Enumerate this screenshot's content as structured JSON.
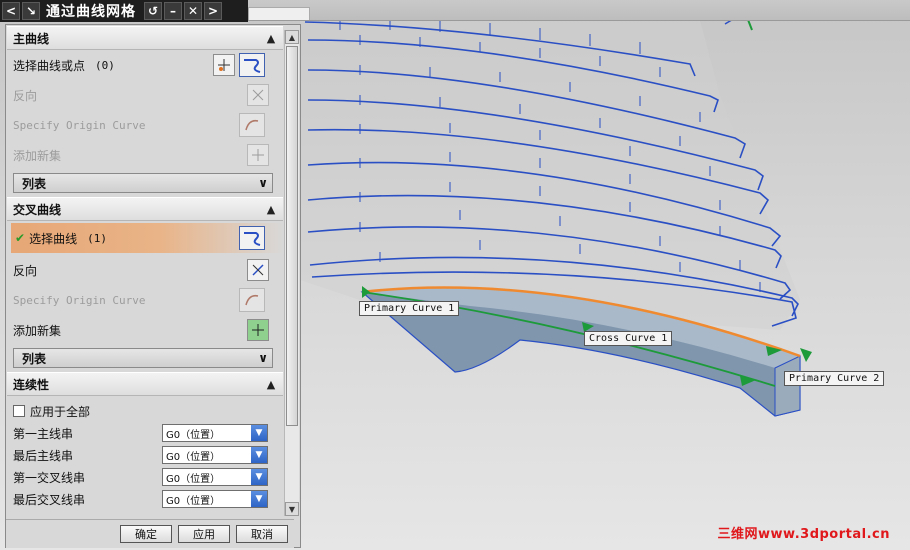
{
  "dialog": {
    "title": "通过曲线网格",
    "sections": {
      "primary": {
        "header": "主曲线",
        "select_label": "选择曲线或点",
        "select_count": "(0)",
        "reverse_label": "反向",
        "origin_label": "Specify Origin Curve",
        "add_set_label": "添加新集",
        "list_label": "列表"
      },
      "cross": {
        "header": "交叉曲线",
        "select_label": "选择曲线",
        "select_count": "(1)",
        "reverse_label": "反向",
        "origin_label": "Specify Origin Curve",
        "add_set_label": "添加新集",
        "list_label": "列表"
      },
      "continuity": {
        "header": "连续性",
        "apply_all_label": "应用于全部",
        "rows": [
          {
            "label": "第一主线串",
            "value": "G0（位置）"
          },
          {
            "label": "最后主线串",
            "value": "G0（位置）"
          },
          {
            "label": "第一交叉线串",
            "value": "G0（位置）"
          },
          {
            "label": "最后交叉线串",
            "value": "G0（位置）"
          }
        ]
      }
    },
    "buttons": {
      "ok": "确定",
      "apply": "应用",
      "cancel": "取消"
    }
  },
  "viewport": {
    "labels": {
      "primary1": "Primary Curve  1",
      "cross1": "Cross Curve  1",
      "primary2": "Primary Curve  2"
    },
    "watermark": "三维网www.3dportal.cn",
    "colors": {
      "curve": "#2a4fc4",
      "primary_highlight": "#f08a30",
      "cross_highlight": "#1d9a3a",
      "surface": "#7f96ad"
    }
  }
}
